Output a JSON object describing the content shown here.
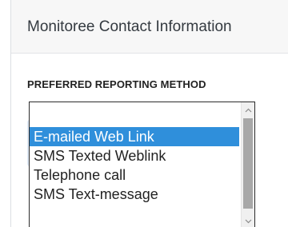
{
  "header": {
    "title": "Monitoree Contact Information"
  },
  "form": {
    "label": "PREFERRED REPORTING METHOD",
    "options": [
      {
        "label": "E-mailed Web Link",
        "selected": true
      },
      {
        "label": "SMS Texted Weblink",
        "selected": false
      },
      {
        "label": "Telephone call",
        "selected": false
      },
      {
        "label": "SMS Text-message",
        "selected": false
      }
    ]
  },
  "colors": {
    "selected_bg": "#2f8fdb",
    "header_bg": "#f7f7f7"
  },
  "icons": {
    "scroll_up": "chevron-up-icon",
    "scroll_down": "chevron-down-icon"
  }
}
